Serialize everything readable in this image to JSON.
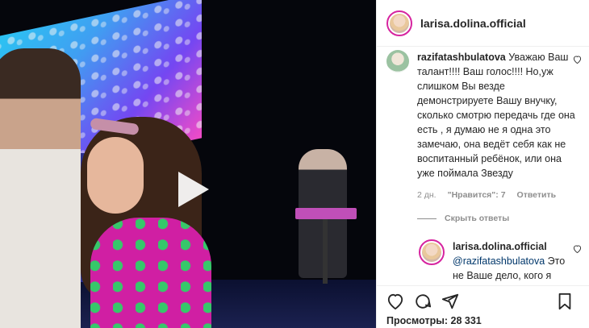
{
  "post": {
    "username": "larisa.dolina.official",
    "views_label": "Просмотры: 28 331"
  },
  "comments": [
    {
      "username": "razifatashbulatova",
      "text": "Уважаю Ваш талант!!!! Ваш голос!!!! Но,уж слишком Вы везде демонстрируете Вашу внучку, сколько смотрю передачь где она есть , я думаю не я одна это замечаю, она ведёт себя как не воспитанный ребёнок, или она уже поймала Звезду",
      "time": "2 дн.",
      "likes": "\"Нравится\": 7",
      "reply_label": "Ответить",
      "hide_replies_label": "Скрыть ответы"
    }
  ],
  "reply": {
    "username": "larisa.dolina.official",
    "mention": "@razifatashbulatova",
    "text": "Это не Ваше дело, кого я демонстрирую, мой аккаунт, что хочу и кого хочу показываю. И, если подобное вызывает у"
  },
  "icons": {
    "like": "heart-icon",
    "comment": "comment-icon",
    "share": "share-icon",
    "save": "bookmark-icon",
    "play": "play-icon",
    "comment_like": "heart-icon"
  },
  "colors": {
    "story_ring": "#d6249f",
    "text": "#262626",
    "muted": "#8e8e8e",
    "border": "#efefef"
  }
}
